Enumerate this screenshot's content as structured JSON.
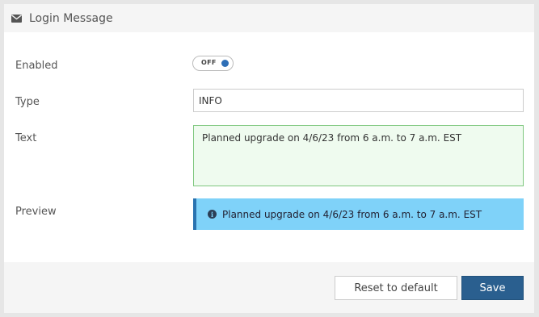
{
  "header": {
    "icon": "envelope-icon",
    "title": "Login Message"
  },
  "form": {
    "enabled": {
      "label": "Enabled",
      "toggle_text": "OFF"
    },
    "type": {
      "label": "Type",
      "value": "INFO"
    },
    "text": {
      "label": "Text",
      "value": "Planned upgrade on 4/6/23 from 6 a.m. to 7 a.m. EST"
    },
    "preview": {
      "label": "Preview",
      "icon": "info-circle-icon",
      "value": "Planned upgrade on 4/6/23 from 6 a.m. to 7 a.m. EST"
    }
  },
  "footer": {
    "reset_label": "Reset to default",
    "save_label": "Save"
  },
  "colors": {
    "preview_bg": "#7fd2f9",
    "preview_border": "#2a73b0",
    "textarea_bg": "#effbef",
    "textarea_border": "#7fc77f",
    "save_button": "#2a5f8f"
  }
}
